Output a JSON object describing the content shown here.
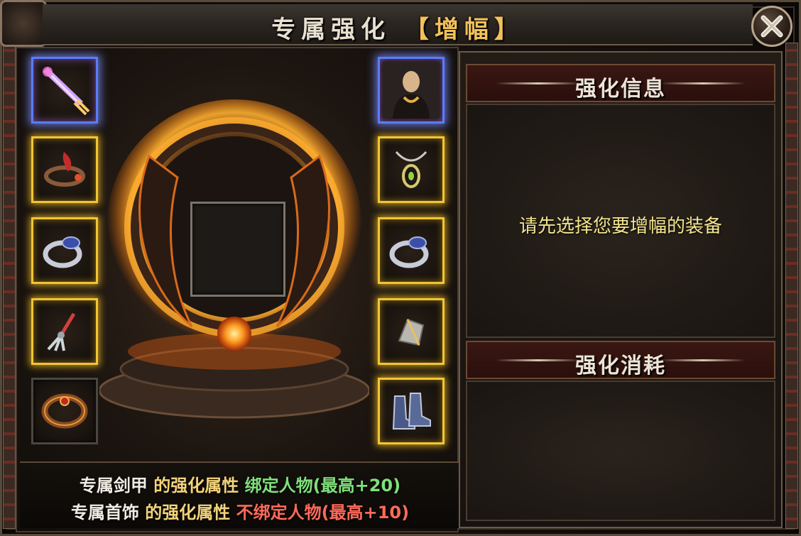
{
  "window": {
    "title_main": "专属强化",
    "title_bracket_open": "【",
    "title_highlight": "增幅",
    "title_bracket_close": "】"
  },
  "close_icon": "close-x-icon",
  "left_slots": [
    {
      "item": "sword-icon",
      "frame": "blue"
    },
    {
      "item": "bracelet-icon",
      "frame": "gold"
    },
    {
      "item": "ring-icon",
      "frame": "gold"
    },
    {
      "item": "claw-weapon-icon",
      "frame": "gold"
    },
    {
      "item": "belt-icon",
      "frame": "plain"
    }
  ],
  "right_slots": [
    {
      "item": "character-portrait-icon",
      "frame": "blue"
    },
    {
      "item": "necklace-icon",
      "frame": "gold"
    },
    {
      "item": "ring-icon",
      "frame": "gold"
    },
    {
      "item": "helmet-icon",
      "frame": "gold"
    },
    {
      "item": "boots-icon",
      "frame": "gold"
    }
  ],
  "info_lines": [
    {
      "part1": "专属剑甲",
      "part2": "的强化属性",
      "part3": "绑定人物(最高+20)",
      "color3": "#7fe07a"
    },
    {
      "part1": "专属首饰",
      "part2": "的强化属性",
      "part3": "不绑定人物(最高+10)",
      "color3": "#ff6a5a"
    }
  ],
  "colors": {
    "part1": "#f0ece4",
    "part2": "#f3d37a"
  },
  "right_panel": {
    "info_title": "强化信息",
    "info_prompt": "请先选择您要增幅的装备",
    "cost_title": "强化消耗"
  }
}
